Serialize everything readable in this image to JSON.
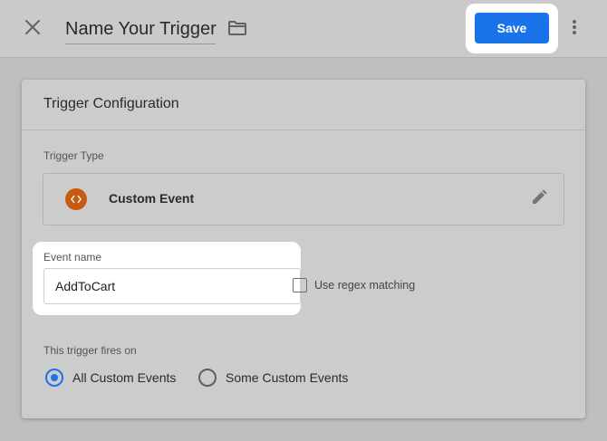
{
  "header": {
    "title": "Name Your Trigger",
    "save_label": "Save",
    "close_icon": "close-icon",
    "folder_icon": "folder-icon",
    "more_icon": "more-vertical-icon",
    "accent_color": "#1a73e8"
  },
  "card": {
    "title": "Trigger Configuration",
    "trigger_type_label": "Trigger Type",
    "trigger_type": {
      "name": "Custom Event",
      "icon": "code-brackets-icon",
      "icon_color": "#c65a0f",
      "edit_icon": "pencil-icon"
    },
    "event_name": {
      "label": "Event name",
      "value": "AddToCart"
    },
    "regex": {
      "label": "Use regex matching",
      "checked": false
    },
    "fires_on": {
      "label": "This trigger fires on",
      "options": [
        {
          "label": "All Custom Events",
          "selected": true
        },
        {
          "label": "Some Custom Events",
          "selected": false
        }
      ]
    }
  }
}
